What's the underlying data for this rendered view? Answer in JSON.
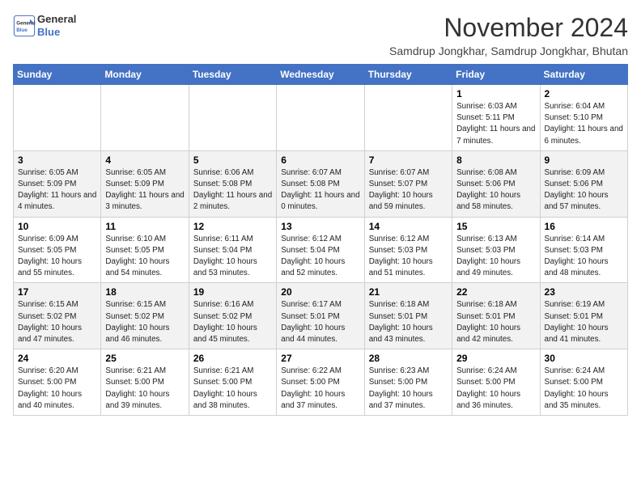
{
  "header": {
    "logo_line1": "General",
    "logo_line2": "Blue",
    "month": "November 2024",
    "location": "Samdrup Jongkhar, Samdrup Jongkhar, Bhutan"
  },
  "weekdays": [
    "Sunday",
    "Monday",
    "Tuesday",
    "Wednesday",
    "Thursday",
    "Friday",
    "Saturday"
  ],
  "weeks": [
    [
      {
        "day": "",
        "info": ""
      },
      {
        "day": "",
        "info": ""
      },
      {
        "day": "",
        "info": ""
      },
      {
        "day": "",
        "info": ""
      },
      {
        "day": "",
        "info": ""
      },
      {
        "day": "1",
        "info": "Sunrise: 6:03 AM\nSunset: 5:11 PM\nDaylight: 11 hours and 7 minutes."
      },
      {
        "day": "2",
        "info": "Sunrise: 6:04 AM\nSunset: 5:10 PM\nDaylight: 11 hours and 6 minutes."
      }
    ],
    [
      {
        "day": "3",
        "info": "Sunrise: 6:05 AM\nSunset: 5:09 PM\nDaylight: 11 hours and 4 minutes."
      },
      {
        "day": "4",
        "info": "Sunrise: 6:05 AM\nSunset: 5:09 PM\nDaylight: 11 hours and 3 minutes."
      },
      {
        "day": "5",
        "info": "Sunrise: 6:06 AM\nSunset: 5:08 PM\nDaylight: 11 hours and 2 minutes."
      },
      {
        "day": "6",
        "info": "Sunrise: 6:07 AM\nSunset: 5:08 PM\nDaylight: 11 hours and 0 minutes."
      },
      {
        "day": "7",
        "info": "Sunrise: 6:07 AM\nSunset: 5:07 PM\nDaylight: 10 hours and 59 minutes."
      },
      {
        "day": "8",
        "info": "Sunrise: 6:08 AM\nSunset: 5:06 PM\nDaylight: 10 hours and 58 minutes."
      },
      {
        "day": "9",
        "info": "Sunrise: 6:09 AM\nSunset: 5:06 PM\nDaylight: 10 hours and 57 minutes."
      }
    ],
    [
      {
        "day": "10",
        "info": "Sunrise: 6:09 AM\nSunset: 5:05 PM\nDaylight: 10 hours and 55 minutes."
      },
      {
        "day": "11",
        "info": "Sunrise: 6:10 AM\nSunset: 5:05 PM\nDaylight: 10 hours and 54 minutes."
      },
      {
        "day": "12",
        "info": "Sunrise: 6:11 AM\nSunset: 5:04 PM\nDaylight: 10 hours and 53 minutes."
      },
      {
        "day": "13",
        "info": "Sunrise: 6:12 AM\nSunset: 5:04 PM\nDaylight: 10 hours and 52 minutes."
      },
      {
        "day": "14",
        "info": "Sunrise: 6:12 AM\nSunset: 5:03 PM\nDaylight: 10 hours and 51 minutes."
      },
      {
        "day": "15",
        "info": "Sunrise: 6:13 AM\nSunset: 5:03 PM\nDaylight: 10 hours and 49 minutes."
      },
      {
        "day": "16",
        "info": "Sunrise: 6:14 AM\nSunset: 5:03 PM\nDaylight: 10 hours and 48 minutes."
      }
    ],
    [
      {
        "day": "17",
        "info": "Sunrise: 6:15 AM\nSunset: 5:02 PM\nDaylight: 10 hours and 47 minutes."
      },
      {
        "day": "18",
        "info": "Sunrise: 6:15 AM\nSunset: 5:02 PM\nDaylight: 10 hours and 46 minutes."
      },
      {
        "day": "19",
        "info": "Sunrise: 6:16 AM\nSunset: 5:02 PM\nDaylight: 10 hours and 45 minutes."
      },
      {
        "day": "20",
        "info": "Sunrise: 6:17 AM\nSunset: 5:01 PM\nDaylight: 10 hours and 44 minutes."
      },
      {
        "day": "21",
        "info": "Sunrise: 6:18 AM\nSunset: 5:01 PM\nDaylight: 10 hours and 43 minutes."
      },
      {
        "day": "22",
        "info": "Sunrise: 6:18 AM\nSunset: 5:01 PM\nDaylight: 10 hours and 42 minutes."
      },
      {
        "day": "23",
        "info": "Sunrise: 6:19 AM\nSunset: 5:01 PM\nDaylight: 10 hours and 41 minutes."
      }
    ],
    [
      {
        "day": "24",
        "info": "Sunrise: 6:20 AM\nSunset: 5:00 PM\nDaylight: 10 hours and 40 minutes."
      },
      {
        "day": "25",
        "info": "Sunrise: 6:21 AM\nSunset: 5:00 PM\nDaylight: 10 hours and 39 minutes."
      },
      {
        "day": "26",
        "info": "Sunrise: 6:21 AM\nSunset: 5:00 PM\nDaylight: 10 hours and 38 minutes."
      },
      {
        "day": "27",
        "info": "Sunrise: 6:22 AM\nSunset: 5:00 PM\nDaylight: 10 hours and 37 minutes."
      },
      {
        "day": "28",
        "info": "Sunrise: 6:23 AM\nSunset: 5:00 PM\nDaylight: 10 hours and 37 minutes."
      },
      {
        "day": "29",
        "info": "Sunrise: 6:24 AM\nSunset: 5:00 PM\nDaylight: 10 hours and 36 minutes."
      },
      {
        "day": "30",
        "info": "Sunrise: 6:24 AM\nSunset: 5:00 PM\nDaylight: 10 hours and 35 minutes."
      }
    ]
  ]
}
